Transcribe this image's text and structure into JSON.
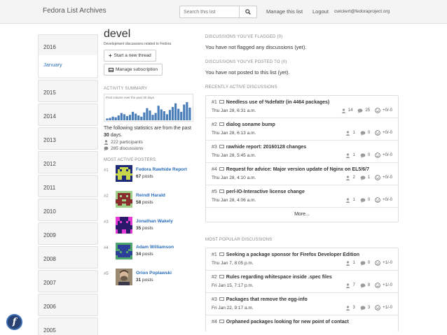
{
  "header": {
    "brand": "Fedora List Archives",
    "search_placeholder": "Search this list",
    "manage_label": "Manage this list",
    "logout_label": "Logout",
    "user_email": "cwickert@fedoraproject.org"
  },
  "sidebar": {
    "years": [
      "2016",
      "2015",
      "2014",
      "2013",
      "2012",
      "2011",
      "2010",
      "2009",
      "2008",
      "2007",
      "2006",
      "2005"
    ],
    "active_month": "January"
  },
  "list": {
    "name": "devel",
    "description": "Development discussions related to Fedora",
    "new_thread_label": "Start a new thread",
    "subscription_label": "Manage subscription"
  },
  "activity": {
    "heading": "ACTIVITY SUMMARY",
    "chart_caption": "Post volume over the past 30 days",
    "stats_text_pre": "The following statistics are from the past ",
    "stats_days": "30",
    "stats_text_post": " days.",
    "participants": "222 participants",
    "discussions": "285 discussions"
  },
  "chart_data": {
    "type": "bar",
    "title": "Post volume over the past 30 days",
    "values": [
      3,
      4,
      6,
      5,
      8,
      12,
      10,
      7,
      9,
      14,
      11,
      8,
      6,
      13,
      20,
      16,
      9,
      12,
      24,
      18,
      15,
      10,
      17,
      22,
      28,
      19,
      14,
      26,
      30,
      21
    ],
    "bar_color": "#4a7eb8"
  },
  "posters": {
    "heading": "MOST ACTIVE POSTERS",
    "items": [
      {
        "rank": "#1",
        "name": "Fedora Rawhide Report",
        "count": "67",
        "unit": "posts"
      },
      {
        "rank": "#2",
        "name": "Reindl Harald",
        "count": "58",
        "unit": "posts"
      },
      {
        "rank": "#3",
        "name": "Jonathan Wakely",
        "count": "35",
        "unit": "posts"
      },
      {
        "rank": "#4",
        "name": "Adam Williamson",
        "count": "34",
        "unit": "posts"
      },
      {
        "rank": "#5",
        "name": "Orion Poplawski",
        "count": "31",
        "unit": "posts"
      }
    ]
  },
  "flagged": {
    "heading": "DISCUSSIONS YOU'VE FLAGGED (0)",
    "message": "You have not flagged any discussions (yet)."
  },
  "posted": {
    "heading": "DISCUSSIONS YOU'VE POSTED TO (0)",
    "message": "You have not posted to this list (yet)."
  },
  "recent": {
    "heading": "RECENTLY ACTIVE DISCUSSIONS",
    "more_label": "More...",
    "items": [
      {
        "num": "#1",
        "title": "Needless use of %defattr (in 4464 packages)",
        "date": "Thu Jan 28, 6:31 a.m.",
        "participants": "14",
        "replies": "25",
        "votes": "+0/-0"
      },
      {
        "num": "#2",
        "title": "dialog soname bump",
        "date": "Thu Jan 28, 6:13 a.m.",
        "participants": "1",
        "replies": "0",
        "votes": "+0/-0"
      },
      {
        "num": "#3",
        "title": "rawhide report: 20160128 changes",
        "date": "Thu Jan 28, 5:45 a.m.",
        "participants": "1",
        "replies": "0",
        "votes": "+0/-0"
      },
      {
        "num": "#4",
        "title": "Request for advice: Major version update of Nginx on EL5/6/7",
        "date": "Thu Jan 28, 4:10 a.m.",
        "participants": "2",
        "replies": "1",
        "votes": "+0/-0"
      },
      {
        "num": "#5",
        "title": "perl-IO-Interactive license change",
        "date": "Thu Jan 28, 4:06 a.m.",
        "participants": "1",
        "replies": "0",
        "votes": "+0/-0"
      }
    ]
  },
  "popular": {
    "heading": "MOST POPULAR DISCUSSIONS",
    "items": [
      {
        "num": "#1",
        "title": "Seeking a package sponsor for Firefox Developer Edition",
        "date": "Thu Jan 7, 8:05 p.m.",
        "participants": "1",
        "replies": "0",
        "votes": "+1/-0"
      },
      {
        "num": "#2",
        "title": "Rules regarding whitespace inside .spec files",
        "date": "Fri Jan 15, 7:17 p.m.",
        "participants": "7",
        "replies": "8",
        "votes": "+1/-0"
      },
      {
        "num": "#3",
        "title": "Packages that remove the egg-info",
        "date": "Fri Jan 22, 9:17 a.m.",
        "participants": "3",
        "replies": "3",
        "votes": "+1/-0"
      },
      {
        "num": "#4",
        "title": "Orphaned packages looking for new point of contact",
        "date": "",
        "participants": "",
        "replies": "",
        "votes": ""
      }
    ]
  },
  "colors": {
    "link": "#2a6ebb",
    "fedora_blue": "#294172"
  }
}
